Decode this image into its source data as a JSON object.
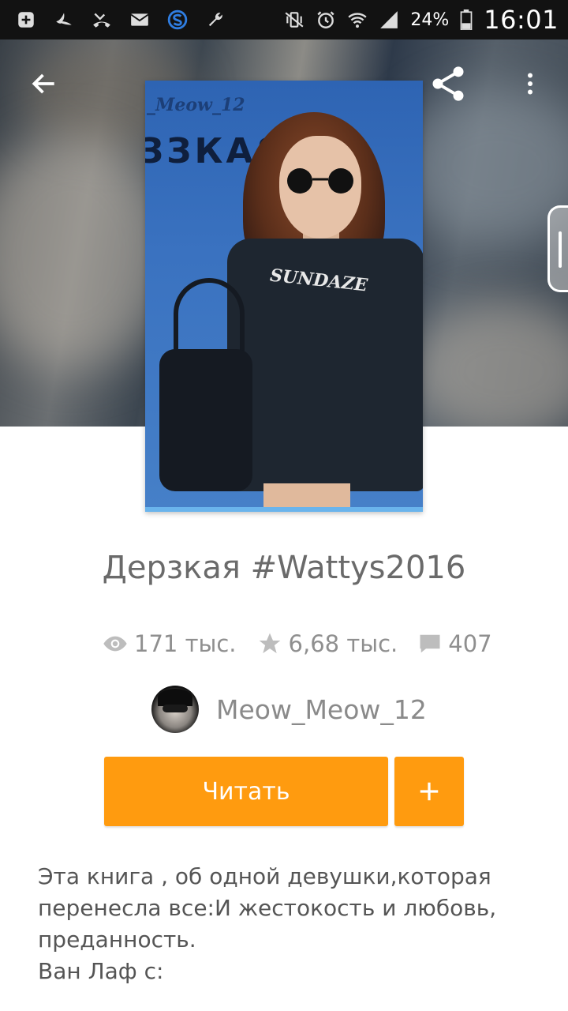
{
  "status_bar": {
    "battery": "24%",
    "time": "16:01"
  },
  "cover": {
    "author_text": "_Meow_12",
    "title_text": "ЗЗКАЯ",
    "shirt_text": "SUNDAZE"
  },
  "book": {
    "title": "Дерзкая #Wattys2016"
  },
  "stats": {
    "reads": "171 тыс.",
    "votes": "6,68 тыс.",
    "comments": "407"
  },
  "author": {
    "name": "Meow_Meow_12"
  },
  "actions": {
    "read_label": "Читать",
    "add_label": "+"
  },
  "description": {
    "lines": [
      "Эта книга , об одной девушки,которая",
      "перенесла все:И жестокость и любовь,",
      "преданность.",
      "Ван Лаф с:"
    ]
  },
  "colors": {
    "accent": "#ff9b0f",
    "status_bar": "#121212",
    "text_muted": "#8f8f8f"
  },
  "icons": {
    "back": "arrow-left-icon",
    "share": "share-icon",
    "more": "more-vert-icon",
    "reads": "eye-icon",
    "votes": "star-icon",
    "comments": "comment-icon"
  }
}
